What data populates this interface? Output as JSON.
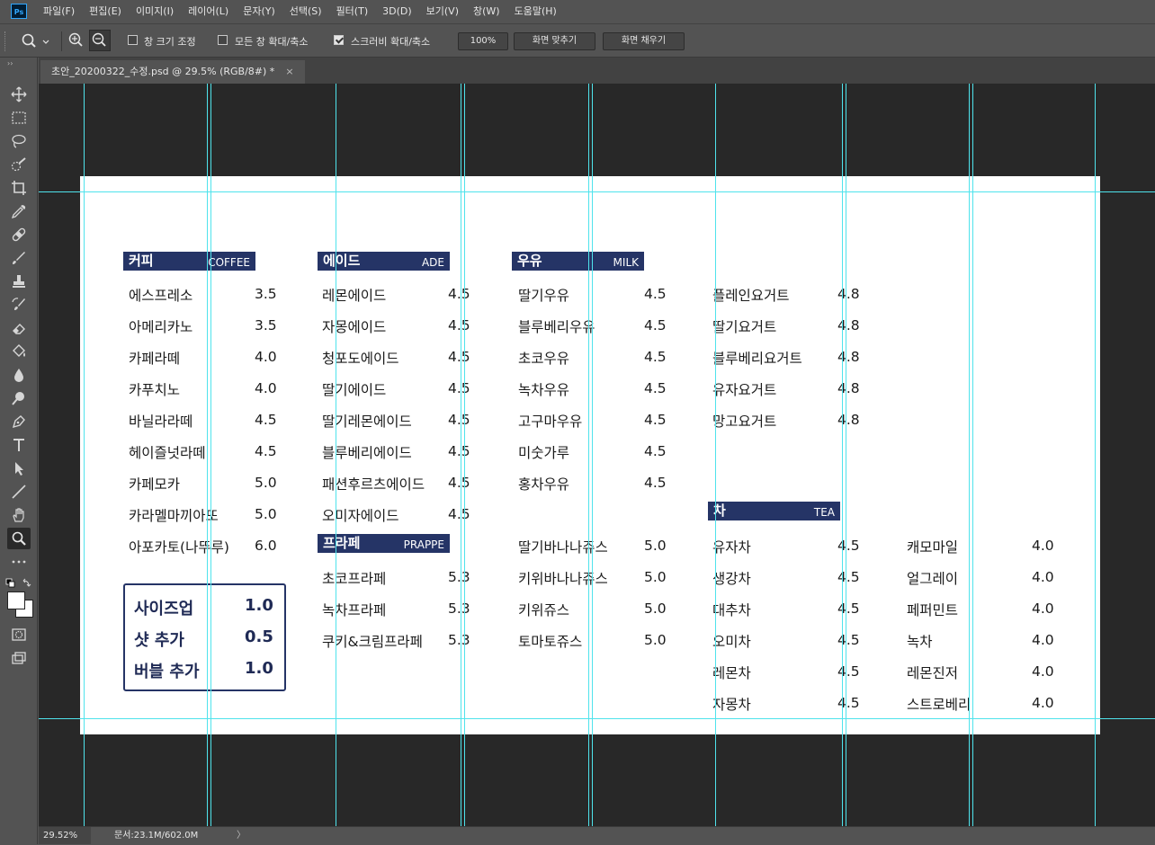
{
  "app": {
    "logo": "Ps"
  },
  "menu": [
    "파일(F)",
    "편집(E)",
    "이미지(I)",
    "레이어(L)",
    "문자(Y)",
    "선택(S)",
    "필터(T)",
    "3D(D)",
    "보기(V)",
    "창(W)",
    "도움말(H)"
  ],
  "options": {
    "resize_windows": "창 크기 조정",
    "zoom_all_windows": "모든 창 확대/축소",
    "scrubby_zoom": "스크러비 확대/축소",
    "zoom_value": "100%",
    "fit_screen": "화면 맞추기",
    "fill_screen": "화면 채우기",
    "resize_windows_checked": false,
    "zoom_all_checked": false,
    "scrubby_checked": true
  },
  "tab": {
    "title": "초안_20200322_수정.psd @ 29.5% (RGB/8#) *",
    "close": "×"
  },
  "status": {
    "zoom": "29.52%",
    "doc_info": "문서:23.1M/602.0M",
    "arrow": "〉"
  },
  "menu_board": {
    "coffee": {
      "title_ko": "커피",
      "title_en": "COFFEE",
      "items": [
        {
          "name": "에스프레소",
          "price": "3.5"
        },
        {
          "name": "아메리카노",
          "price": "3.5"
        },
        {
          "name": "카페라떼",
          "price": "4.0"
        },
        {
          "name": "카푸치노",
          "price": "4.0"
        },
        {
          "name": "바닐라라떼",
          "price": "4.5"
        },
        {
          "name": "헤이즐넛라떼",
          "price": "4.5"
        },
        {
          "name": "카페모카",
          "price": "5.0"
        },
        {
          "name": "카라멜마끼아또",
          "price": "5.0"
        },
        {
          "name": "아포카토(나뚜루)",
          "price": "6.0"
        }
      ]
    },
    "ade": {
      "title_ko": "에이드",
      "title_en": "ADE",
      "items": [
        {
          "name": "레몬에이드",
          "price": "4.5"
        },
        {
          "name": "자몽에이드",
          "price": "4.5"
        },
        {
          "name": "청포도에이드",
          "price": "4.5"
        },
        {
          "name": "딸기에이드",
          "price": "4.5"
        },
        {
          "name": "딸기레몬에이드",
          "price": "4.5"
        },
        {
          "name": "블루베리에이드",
          "price": "4.5"
        },
        {
          "name": "패션후르츠에이드",
          "price": "4.5"
        },
        {
          "name": "오미자에이드",
          "price": "4.5"
        }
      ]
    },
    "frappe": {
      "title_ko": "프라페",
      "title_en": "PRAPPE",
      "items": [
        {
          "name": "초코프라페",
          "price": "5.3"
        },
        {
          "name": "녹차프라페",
          "price": "5.3"
        },
        {
          "name": "쿠키&크림프라페",
          "price": "5.3"
        }
      ]
    },
    "milk": {
      "title_ko": "우유",
      "title_en": "MILK",
      "items": [
        {
          "name": "딸기우유",
          "price": "4.5"
        },
        {
          "name": "블루베리우유",
          "price": "4.5"
        },
        {
          "name": "초코우유",
          "price": "4.5"
        },
        {
          "name": "녹차우유",
          "price": "4.5"
        },
        {
          "name": "고구마우유",
          "price": "4.5"
        },
        {
          "name": "미숫가루",
          "price": "4.5"
        },
        {
          "name": "홍차우유",
          "price": "4.5"
        }
      ]
    },
    "juice": {
      "items": [
        {
          "name": "딸기바나나쥬스",
          "price": "5.0"
        },
        {
          "name": "키위바나나쥬스",
          "price": "5.0"
        },
        {
          "name": "키위쥬스",
          "price": "5.0"
        },
        {
          "name": "토마토쥬스",
          "price": "5.0"
        }
      ]
    },
    "yogurt": {
      "items": [
        {
          "name": "플레인요거트",
          "price": "4.8"
        },
        {
          "name": "딸기요거트",
          "price": "4.8"
        },
        {
          "name": "블루베리요거트",
          "price": "4.8"
        },
        {
          "name": "유자요거트",
          "price": "4.8"
        },
        {
          "name": "망고요거트",
          "price": "4.8"
        }
      ]
    },
    "tea": {
      "title_ko": "차",
      "title_en": "TEA",
      "col1": [
        {
          "name": "유자차",
          "price": "4.5"
        },
        {
          "name": "생강차",
          "price": "4.5"
        },
        {
          "name": "대추차",
          "price": "4.5"
        },
        {
          "name": "오미차",
          "price": "4.5"
        },
        {
          "name": "레몬차",
          "price": "4.5"
        },
        {
          "name": "자몽차",
          "price": "4.5"
        }
      ],
      "col2": [
        {
          "name": "캐모마일",
          "price": "4.0"
        },
        {
          "name": "얼그레이",
          "price": "4.0"
        },
        {
          "name": "페퍼민트",
          "price": "4.0"
        },
        {
          "name": "녹차",
          "price": "4.0"
        },
        {
          "name": "레몬진저",
          "price": "4.0"
        },
        {
          "name": "스트로베리",
          "price": "4.0"
        }
      ]
    },
    "extras": [
      {
        "name": "사이즈업",
        "price": "1.0"
      },
      {
        "name": "샷 추가",
        "price": "0.5"
      },
      {
        "name": "버블 추가",
        "price": "1.0"
      }
    ]
  }
}
